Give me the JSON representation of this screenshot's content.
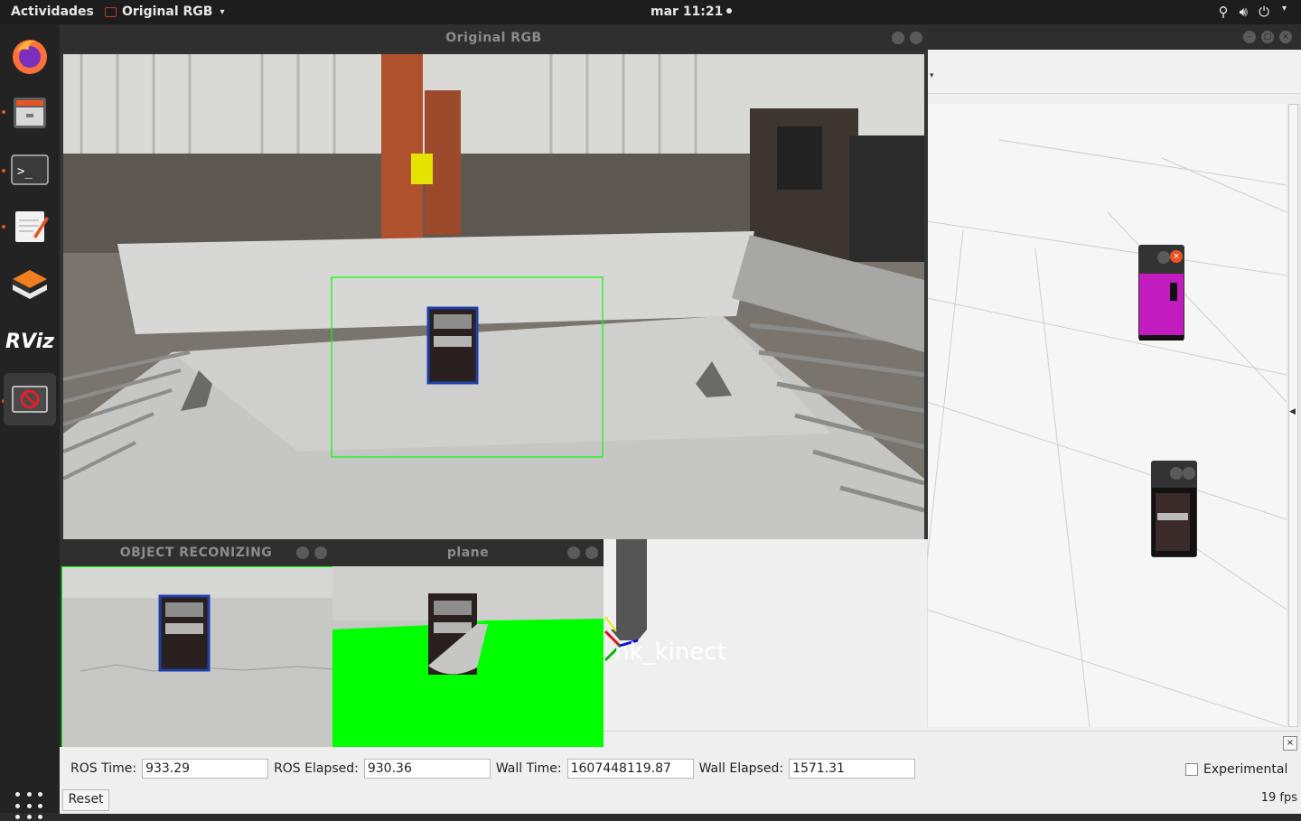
{
  "topbar": {
    "activities": "Actividades",
    "app_name": "Original RGB",
    "clock": "mar 11:21"
  },
  "dock": {
    "items": [
      "firefox-icon",
      "files-icon",
      "terminal-icon",
      "text-editor-icon",
      "virtualbox-icon",
      "rviz-icon",
      "image-viewer-icon"
    ],
    "rviz_label": "RViz"
  },
  "windows": {
    "original_rgb": {
      "title": "Original RGB"
    },
    "object_recognizing": {
      "title": "OBJECT RECONIZING"
    },
    "plane": {
      "title": "plane"
    }
  },
  "rviz": {
    "frame_label": "nk_kinect",
    "ros_time_label": "ROS Time:",
    "ros_time_value": "933.29",
    "ros_elapsed_label": "ROS Elapsed:",
    "ros_elapsed_value": "930.36",
    "wall_time_label": "Wall Time:",
    "wall_time_value": "1607448119.87",
    "wall_elapsed_label": "Wall Elapsed:",
    "wall_elapsed_value": "1571.31",
    "experimental_label": "Experimental",
    "reset_label": "Reset",
    "fps": "19 fps"
  },
  "colors": {
    "topbar": "#1d1d1d",
    "dock": "#232323",
    "detection_green": "#00ff00",
    "bbox_blue": "#1f3fa8",
    "segment_magenta": "#c21cc0",
    "ubuntu_orange": "#e95420"
  }
}
